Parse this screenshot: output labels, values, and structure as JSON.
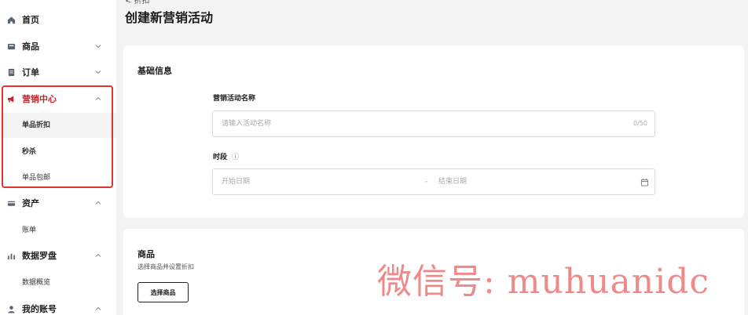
{
  "sidebar": {
    "items": [
      {
        "label": "首页",
        "icon": "home-icon"
      },
      {
        "label": "商品",
        "icon": "product-icon"
      },
      {
        "label": "订单",
        "icon": "order-icon"
      },
      {
        "label": "营销中心",
        "icon": "megaphone-icon"
      },
      {
        "label": "资产",
        "icon": "card-icon"
      },
      {
        "label": "数据罗盘",
        "icon": "chart-icon"
      },
      {
        "label": "我的账号",
        "icon": "user-icon"
      }
    ],
    "marketing_sub": [
      "单品折扣",
      "秒杀",
      "单品包邮"
    ],
    "assets_sub": [
      "账单"
    ],
    "data_sub": [
      "数据概览"
    ]
  },
  "header": {
    "back": "< 折扣",
    "title": "创建新营销活动"
  },
  "basic": {
    "title": "基础信息",
    "name_label": "营销活动名称",
    "name_placeholder": "请输入活动名称",
    "name_counter": "0/50",
    "period_label": "时段",
    "period_info_icon": "ⓘ",
    "start_placeholder": "开始日期",
    "separator": "-",
    "end_placeholder": "结束日期"
  },
  "products": {
    "title": "商品",
    "subtitle": "选择商品并设置折扣",
    "select_button": "选择商品"
  },
  "watermark": "微信号: muhuanidc",
  "colors": {
    "highlight": "#e5322d",
    "accent": "#c0272d",
    "watermark": "#f08a8a"
  }
}
